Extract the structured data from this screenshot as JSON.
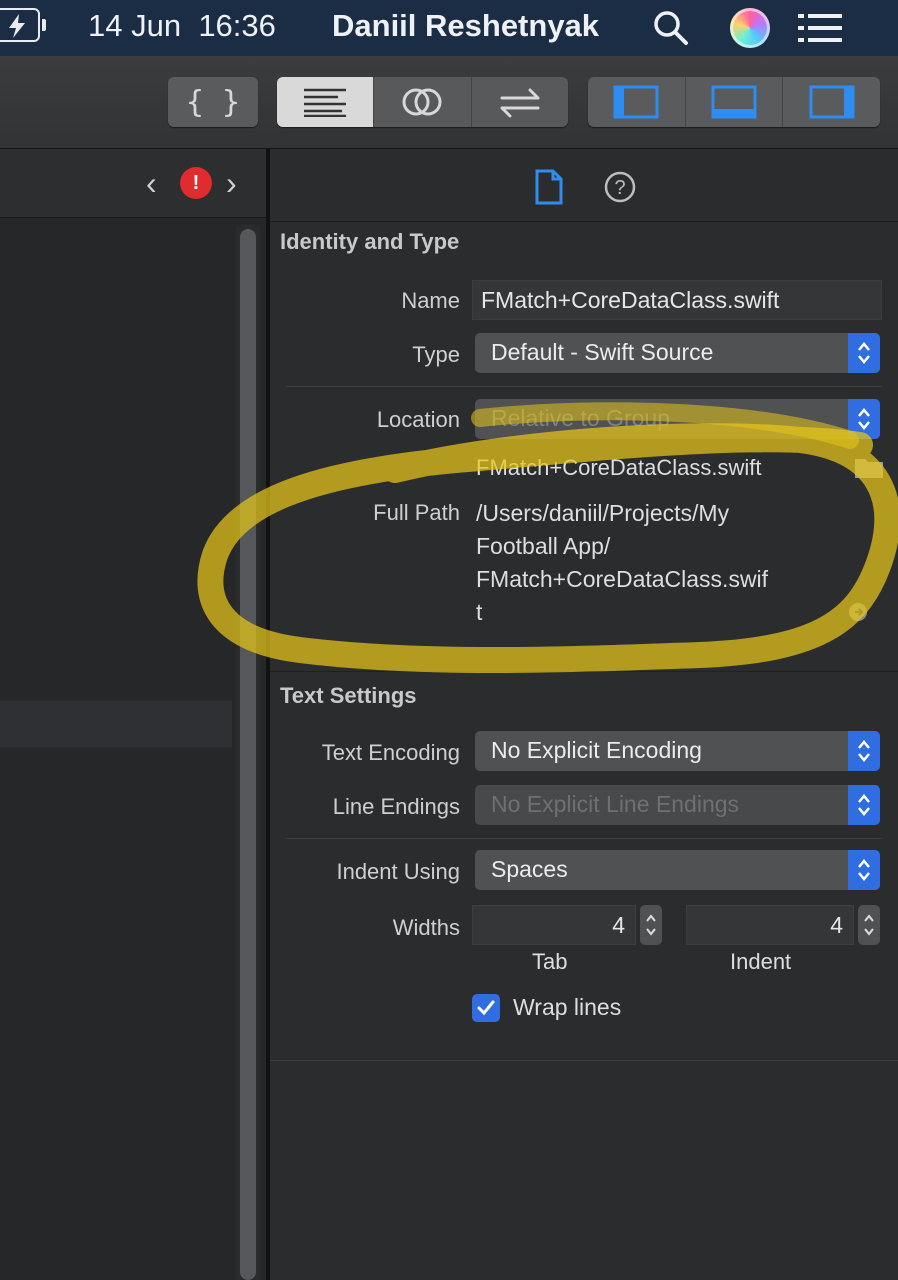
{
  "menubar": {
    "date": "14 Jun",
    "time": "16:36",
    "user": "Daniil Reshetnyak",
    "icons": [
      "battery-charging-icon",
      "search-icon",
      "siri-icon",
      "list-icon"
    ]
  },
  "toolbar": {
    "braces_label": "{ }",
    "editor_modes": [
      "standard-editor-icon",
      "assistant-editor-icon",
      "version-editor-icon"
    ],
    "layout_toggles": [
      "navigator-panel-icon",
      "debug-panel-icon",
      "utilities-panel-icon"
    ]
  },
  "editor": {
    "nav_back": "‹",
    "nav_forward": "›",
    "error_badge": "!"
  },
  "inspector": {
    "tabs": [
      "file-inspector-icon",
      "quick-help-icon"
    ],
    "identity": {
      "title": "Identity and Type",
      "name_label": "Name",
      "name_value": "FMatch+CoreDataClass.swift",
      "type_label": "Type",
      "type_value": "Default - Swift Source",
      "location_label": "Location",
      "location_value": "Relative to Group",
      "location_file": "FMatch+CoreDataClass.swift",
      "fullpath_label": "Full Path",
      "fullpath_lines": [
        "/Users/daniil/Projects/My",
        "Football App/",
        "FMatch+CoreDataClass.swif",
        "t"
      ]
    },
    "text_settings": {
      "title": "Text Settings",
      "encoding_label": "Text Encoding",
      "encoding_value": "No Explicit Encoding",
      "line_endings_label": "Line Endings",
      "line_endings_value": "No Explicit Line Endings",
      "indent_using_label": "Indent Using",
      "indent_using_value": "Spaces",
      "widths_label": "Widths",
      "tab_value": "4",
      "indent_value": "4",
      "tab_caption": "Tab",
      "indent_caption": "Indent",
      "wrap_label": "Wrap lines",
      "wrap_checked": true
    }
  },
  "colors": {
    "accent": "#2f6de1",
    "highlight_marker": "#e6c619",
    "error": "#e02c2c"
  }
}
